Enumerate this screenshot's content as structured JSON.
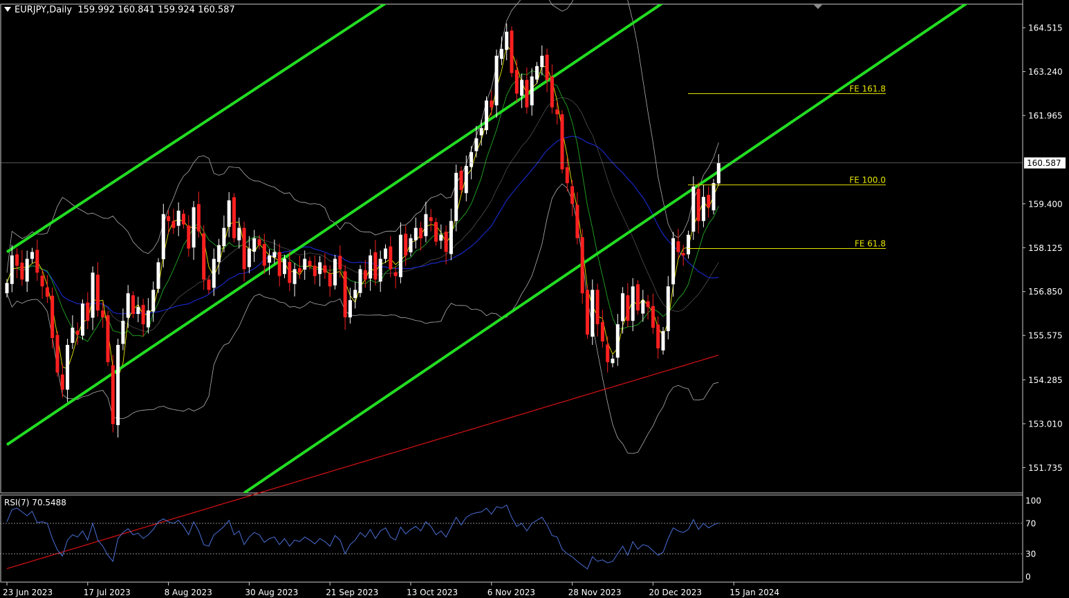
{
  "header": {
    "symbol": "EURJPY,Daily",
    "ohlc": "159.992 160.841 159.924 160.587"
  },
  "rsi": {
    "label": "RSI(7) 70.5488"
  },
  "colors": {
    "background": "#000000",
    "bull": "#ffffff",
    "bear": "#ff2020",
    "channel": "#22dd22",
    "fib": "#e6e600",
    "ma_fast": "#e6e600",
    "ma_mid": "#22aa22",
    "ma_slow": "#1a2bd6",
    "ma_long": "#dd1111",
    "bands": "#b0b0b0",
    "rsi_line": "#4a6fd6",
    "grid": "#ffffff"
  },
  "chart_data": {
    "type": "candlestick",
    "instrument": "EURJPY",
    "timeframe": "Daily",
    "last_price": 160.587,
    "ohlc_last": {
      "open": 159.992,
      "high": 160.841,
      "low": 159.924,
      "close": 160.587
    },
    "price_ylim": [
      151.0,
      165.2
    ],
    "y_ticks": [
      164.515,
      163.24,
      161.965,
      160.587,
      159.4,
      158.125,
      156.85,
      155.575,
      154.285,
      153.01,
      151.735
    ],
    "y_tick_labels": [
      "164.515",
      "163.240",
      "161.965",
      "160.587",
      "159.400",
      "158.125",
      "156.850",
      "155.575",
      "154.285",
      "153.010",
      "151.735"
    ],
    "x_labels": [
      {
        "bar": 0,
        "label": "23 Jun 2023"
      },
      {
        "bar": 16,
        "label": "17 Jul 2023"
      },
      {
        "bar": 32,
        "label": "8 Aug 2023"
      },
      {
        "bar": 48,
        "label": "30 Aug 2023"
      },
      {
        "bar": 64,
        "label": "21 Sep 2023"
      },
      {
        "bar": 80,
        "label": "13 Oct 2023"
      },
      {
        "bar": 96,
        "label": "6 Nov 2023"
      },
      {
        "bar": 112,
        "label": "28 Nov 2023"
      },
      {
        "bar": 128,
        "label": "20 Dec 2023"
      },
      {
        "bar": 144,
        "label": "15 Jan 2024"
      }
    ],
    "closes": [
      157.1,
      157.9,
      157.6,
      157.2,
      157.8,
      158.0,
      157.4,
      157.0,
      156.7,
      155.5,
      154.5,
      154.0,
      155.3,
      155.8,
      155.6,
      156.5,
      156.0,
      157.4,
      156.3,
      156.1,
      154.8,
      153.0,
      155.3,
      156.0,
      156.8,
      156.2,
      156.4,
      155.9,
      156.3,
      156.9,
      157.7,
      159.1,
      158.9,
      158.7,
      159.2,
      158.8,
      158.1,
      159.3,
      158.6,
      157.2,
      156.9,
      157.8,
      158.2,
      158.7,
      159.5,
      158.4,
      158.7,
      157.5,
      158.1,
      158.4,
      158.2,
      157.6,
      157.9,
      158.0,
      157.3,
      157.8,
      157.1,
      157.5,
      157.4,
      157.8,
      157.6,
      157.3,
      157.7,
      157.4,
      157.0,
      157.8,
      157.5,
      156.1,
      156.6,
      156.9,
      157.5,
      157.2,
      157.9,
      157.2,
      157.8,
      158.1,
      157.5,
      157.3,
      158.5,
      157.9,
      158.4,
      158.7,
      158.4,
      159.1,
      158.9,
      158.3,
      158.5,
      158.0,
      158.9,
      160.3,
      159.8,
      160.5,
      160.9,
      161.3,
      161.6,
      162.4,
      162.2,
      163.7,
      163.9,
      164.4,
      163.2,
      162.6,
      163.0,
      162.2,
      163.1,
      163.4,
      163.7,
      163.0,
      162.2,
      162.0,
      160.4,
      160.0,
      159.4,
      158.4,
      156.8,
      155.6,
      156.9,
      155.9,
      155.4,
      154.8,
      154.9,
      155.9,
      156.8,
      156.0,
      157.0,
      156.3,
      156.6,
      156.4,
      155.8,
      155.2,
      155.7,
      157.0,
      158.4,
      158.0,
      157.9,
      158.5,
      159.9,
      158.9,
      159.6,
      159.3,
      160.0,
      160.587
    ],
    "channel_lines": [
      {
        "from": {
          "bar": 0,
          "price": 158.0
        },
        "to": {
          "bar": 81,
          "price": 165.8
        }
      },
      {
        "from": {
          "bar": 0,
          "price": 152.4
        },
        "to": {
          "bar": 163,
          "price": 168.5
        }
      },
      {
        "from": {
          "bar": 47,
          "price": 151.0
        },
        "to": {
          "bar": 201,
          "price": 166.3
        }
      }
    ],
    "fibonacci_extensions": [
      {
        "label": "FE 161.8",
        "price": 162.6
      },
      {
        "label": "FE 100.0",
        "price": 159.95
      },
      {
        "label": "FE 61.8",
        "price": 158.1
      }
    ],
    "indicators": [
      "Moving averages (fast, mid, slow, long)",
      "Bollinger Bands"
    ],
    "rsi": {
      "period": 7,
      "value": 70.5488,
      "ylim": [
        0,
        100
      ],
      "y_ticks": [
        100,
        70,
        30,
        0
      ],
      "levels": [
        70,
        30
      ],
      "values": [
        72,
        88,
        90,
        85,
        80,
        86,
        71,
        72,
        70,
        50,
        35,
        27,
        48,
        55,
        52,
        60,
        48,
        70,
        48,
        40,
        28,
        20,
        50,
        58,
        63,
        55,
        57,
        50,
        55,
        62,
        72,
        76,
        72,
        70,
        74,
        66,
        55,
        72,
        60,
        42,
        40,
        55,
        60,
        66,
        74,
        55,
        60,
        42,
        52,
        58,
        55,
        45,
        50,
        52,
        42,
        50,
        40,
        48,
        46,
        52,
        48,
        43,
        50,
        46,
        40,
        54,
        48,
        30,
        42,
        48,
        58,
        52,
        62,
        50,
        60,
        64,
        52,
        48,
        65,
        56,
        62,
        66,
        60,
        72,
        66,
        55,
        60,
        52,
        65,
        78,
        68,
        78,
        82,
        84,
        85,
        90,
        82,
        92,
        90,
        94,
        78,
        66,
        70,
        60,
        70,
        74,
        78,
        68,
        54,
        52,
        36,
        30,
        26,
        20,
        15,
        10,
        26,
        20,
        22,
        18,
        20,
        30,
        40,
        28,
        46,
        36,
        42,
        40,
        34,
        28,
        32,
        50,
        64,
        60,
        58,
        62,
        75,
        62,
        70,
        64,
        68,
        70.5
      ]
    }
  }
}
